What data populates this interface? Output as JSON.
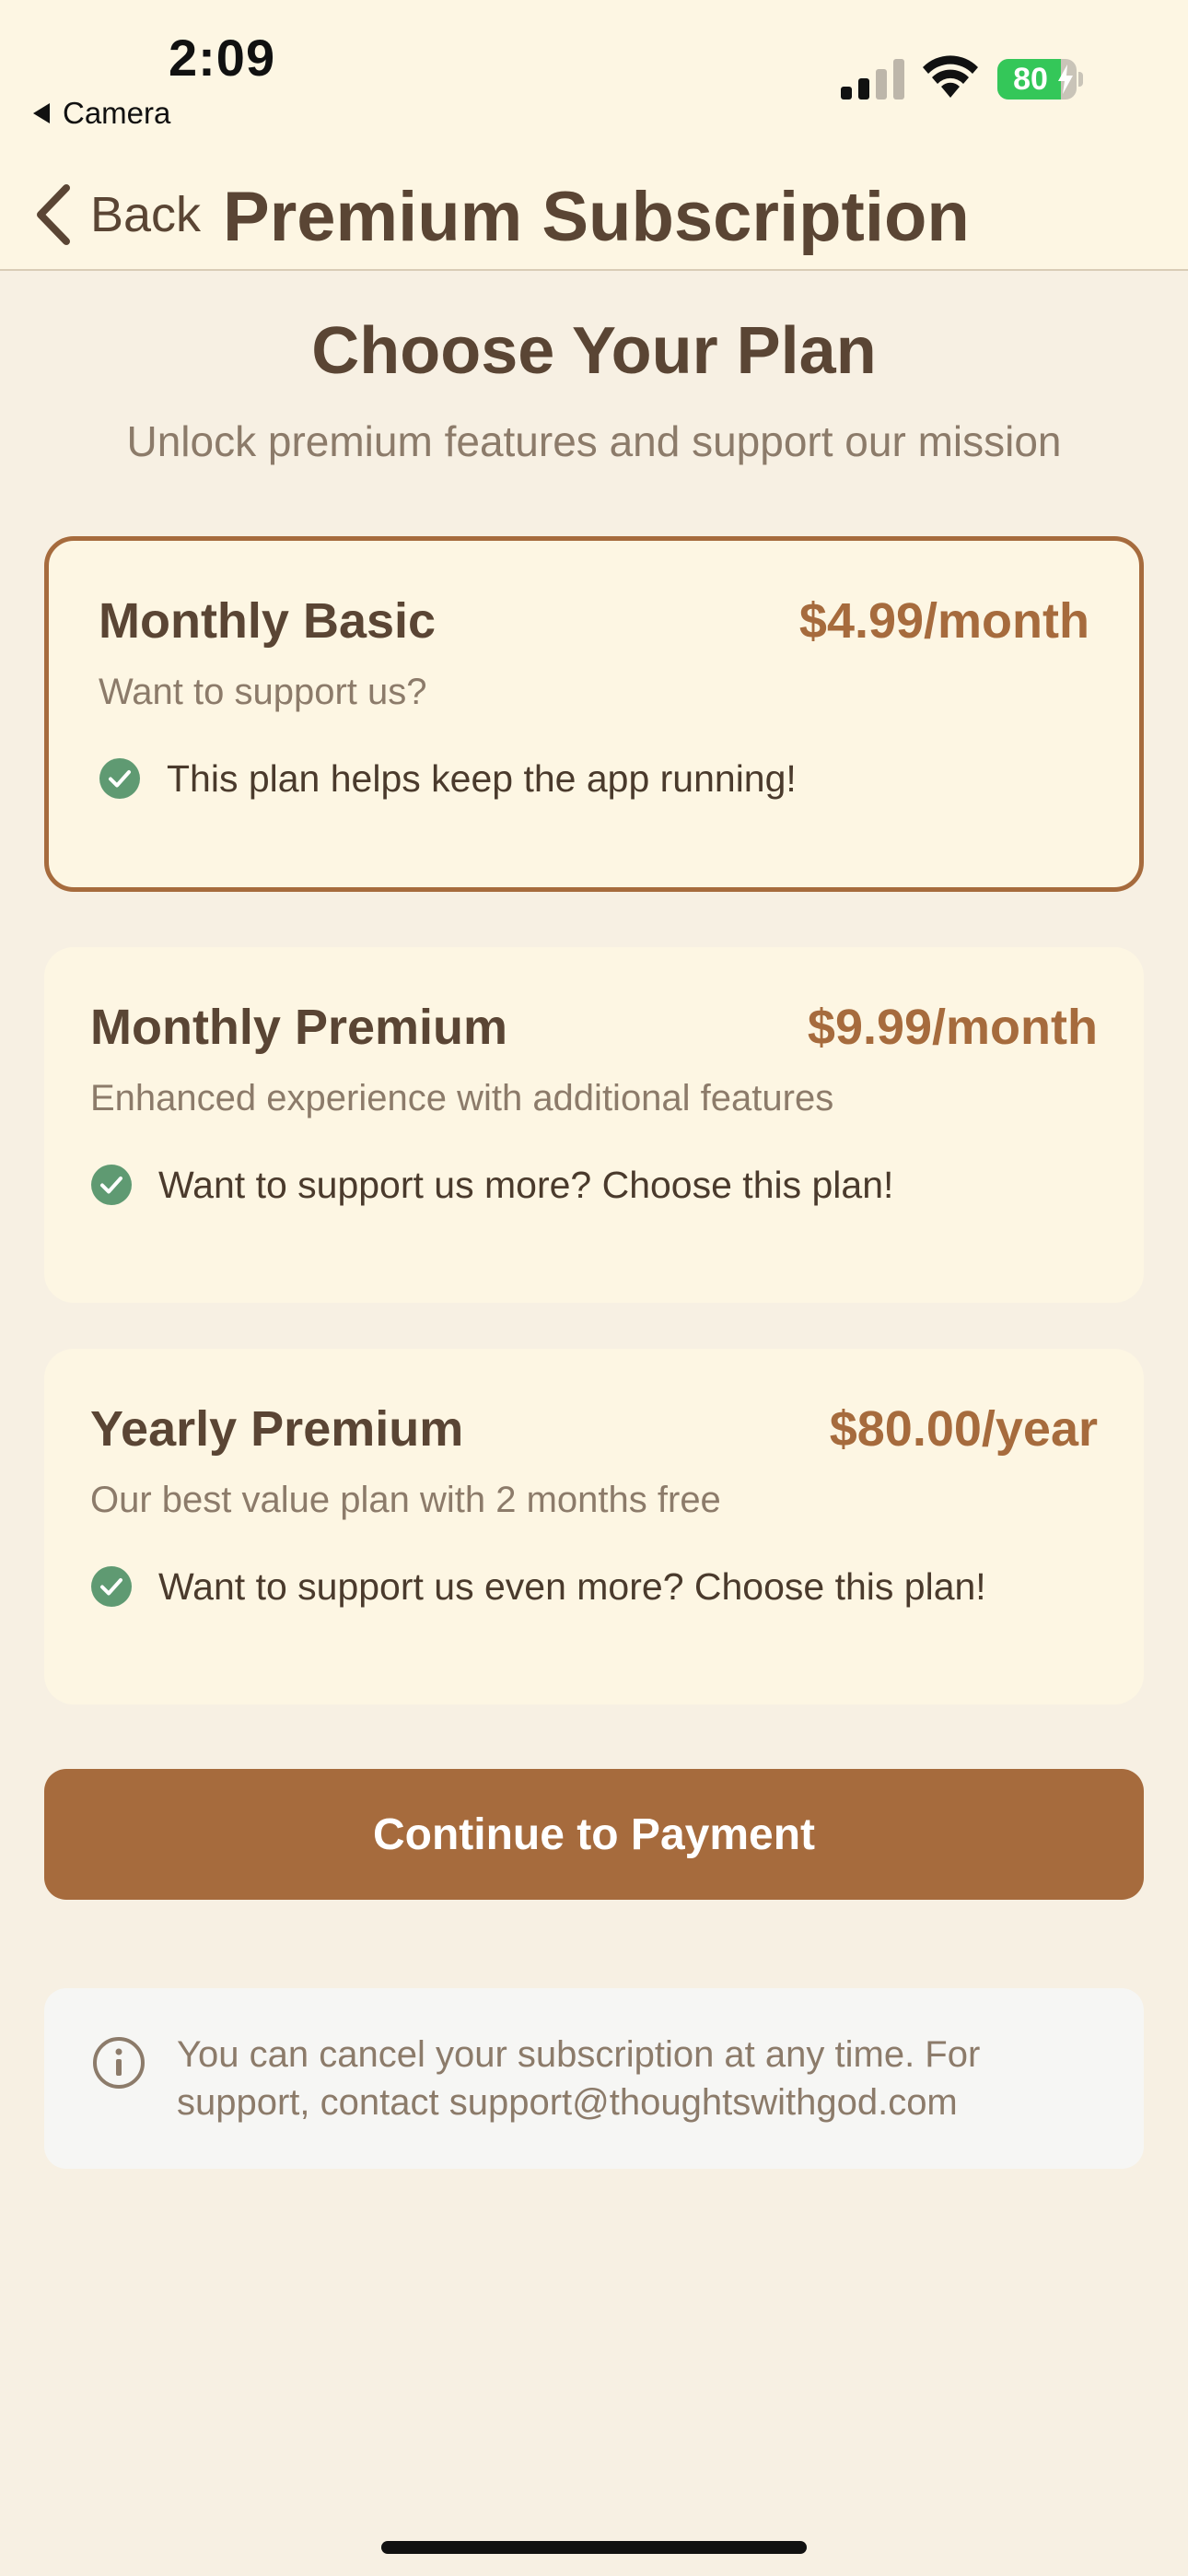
{
  "status_bar": {
    "time": "2:09",
    "back_app": "Camera",
    "battery_level": 80,
    "battery_text": "80"
  },
  "nav": {
    "back_label": "Back",
    "title": "Premium Subscription"
  },
  "header": {
    "title": "Choose Your Plan",
    "subtitle": "Unlock premium features and support our mission"
  },
  "plans": [
    {
      "name": "Monthly Basic",
      "price": "$4.99/month",
      "description": "Want to support us?",
      "feature": "This plan helps keep the app running!",
      "selected": true
    },
    {
      "name": "Monthly Premium",
      "price": "$9.99/month",
      "description": "Enhanced experience with additional features",
      "feature": "Want to support us more? Choose this plan!",
      "selected": false
    },
    {
      "name": "Yearly Premium",
      "price": "$80.00/year",
      "description": "Our best value plan with 2 months free",
      "feature": "Want to support us even more? Choose this plan!",
      "selected": false
    }
  ],
  "continue_button": {
    "label": "Continue to Payment"
  },
  "info": {
    "text": "You can cancel your subscription at any time. For support, contact support@thoughtswithgod.com"
  },
  "colors": {
    "background": "#f7f0e3",
    "card": "#fdf6e3",
    "accent": "#a66b3d",
    "text_primary": "#5a4534",
    "text_secondary": "#8c7b6a",
    "check_green": "#5f9a72"
  }
}
